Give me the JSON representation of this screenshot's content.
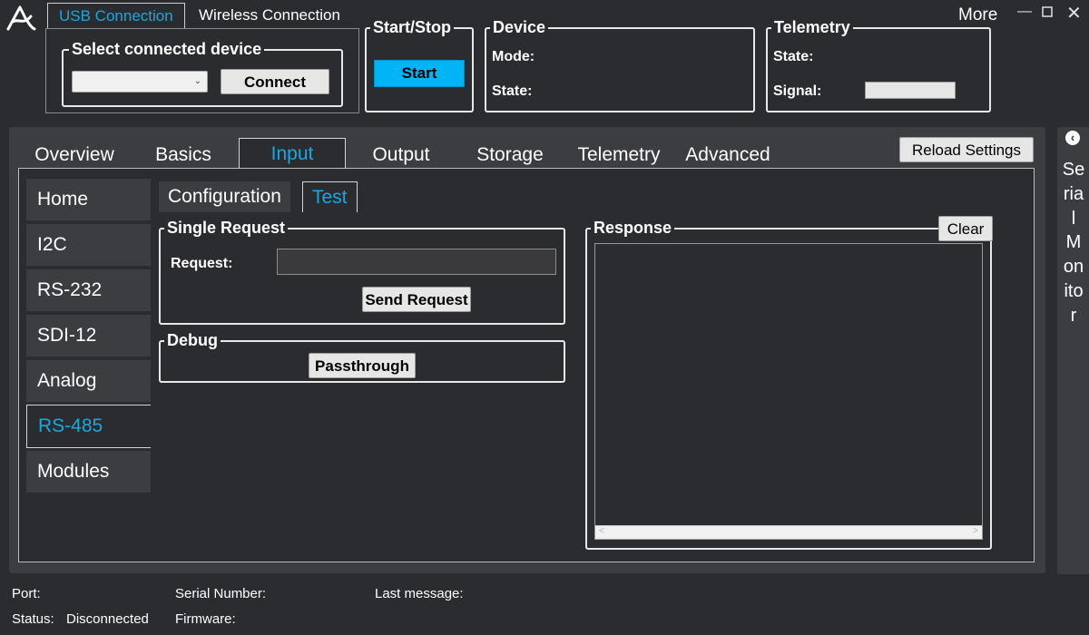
{
  "connection_tabs": [
    "USB Connection",
    "Wireless Connection"
  ],
  "usb": {
    "select_title": "Select connected device",
    "selected_device": "",
    "connect_label": "Connect"
  },
  "start_stop": {
    "title": "Start/Stop",
    "start_label": "Start"
  },
  "device": {
    "title": "Device",
    "mode_label": "Mode:",
    "mode_value": "",
    "state_label": "State:",
    "state_value": ""
  },
  "telemetry": {
    "title": "Telemetry",
    "state_label": "State:",
    "state_value": "",
    "signal_label": "Signal:",
    "signal_level": 0
  },
  "window": {
    "more_label": "More"
  },
  "main_tabs": [
    "Overview",
    "Basics",
    "Input",
    "Output",
    "Storage",
    "Telemetry",
    "Advanced"
  ],
  "active_main_tab": "Input",
  "reload_label": "Reload Settings",
  "sidebar": [
    "Home",
    "I2C",
    "RS-232",
    "SDI-12",
    "Analog",
    "RS-485",
    "Modules"
  ],
  "active_sidebar": "RS-485",
  "sub_tabs": [
    "Configuration",
    "Test"
  ],
  "active_sub_tab": "Test",
  "single_request": {
    "title": "Single Request",
    "request_label": "Request:",
    "request_value": "",
    "send_label": "Send Request"
  },
  "debug": {
    "title": "Debug",
    "passthrough_label": "Passthrough"
  },
  "response": {
    "title": "Response",
    "clear_label": "Clear",
    "content": ""
  },
  "serial_monitor": {
    "label": "Serial Monitor"
  },
  "status_bar": {
    "port_label": "Port:",
    "port_value": "",
    "status_label": "Status:",
    "status_value": "Disconnected",
    "serial_label": "Serial Number:",
    "serial_value": "",
    "firmware_label": "Firmware:",
    "firmware_value": "",
    "last_message_label": "Last message:",
    "last_message_value": ""
  },
  "colors": {
    "accent": "#18a8e0",
    "start_button": "#00b4f5",
    "background": "#2b2c2f",
    "panel": "#3c3d41"
  }
}
